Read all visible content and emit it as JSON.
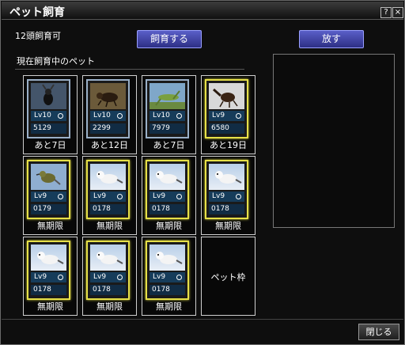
{
  "window": {
    "title": "ペット飼育",
    "help_label": "?",
    "close_label": "×"
  },
  "capacity_text": "12頭飼育可",
  "buttons": {
    "raise": "飼育する",
    "release": "放す",
    "close": "閉じる"
  },
  "section_label": "現在飼育中のペット",
  "pets": [
    {
      "level": "Lv10",
      "number": "5129",
      "remaining": "あと7日",
      "frame": "steel",
      "image": "stag-beetle-icon",
      "thumb_bg": "#3e4e60"
    },
    {
      "level": "Lv10",
      "number": "2299",
      "remaining": "あと12日",
      "frame": "steel",
      "image": "beetle-icon",
      "thumb_bg": "#6b5a3a"
    },
    {
      "level": "Lv10",
      "number": "7979",
      "remaining": "あと7日",
      "frame": "steel",
      "image": "grasshopper-icon",
      "thumb_bg": "#7fa7c9"
    },
    {
      "level": "Lv9",
      "number": "6580",
      "remaining": "あと19日",
      "frame": "gold",
      "image": "rhinoceros-beetle-icon",
      "thumb_bg": "#d8d8d8"
    },
    {
      "level": "Lv9",
      "number": "0179",
      "remaining": "無期限",
      "frame": "gold",
      "image": "bird-icon",
      "thumb_bg": "#8faed0"
    },
    {
      "level": "Lv9",
      "number": "0178",
      "remaining": "無期限",
      "frame": "gold",
      "image": "ferret-icon",
      "thumb_bg": "#9ab8d8"
    },
    {
      "level": "Lv9",
      "number": "0178",
      "remaining": "無期限",
      "frame": "gold",
      "image": "ferret-icon",
      "thumb_bg": "#9ab8d8"
    },
    {
      "level": "Lv9",
      "number": "0178",
      "remaining": "無期限",
      "frame": "gold",
      "image": "ferret-icon",
      "thumb_bg": "#9ab8d8"
    },
    {
      "level": "Lv9",
      "number": "0178",
      "remaining": "無期限",
      "frame": "gold",
      "image": "ferret-icon",
      "thumb_bg": "#9ab8d8"
    },
    {
      "level": "Lv9",
      "number": "0178",
      "remaining": "無期限",
      "frame": "gold",
      "image": "ferret-icon",
      "thumb_bg": "#9ab8d8"
    },
    {
      "level": "Lv9",
      "number": "0178",
      "remaining": "無期限",
      "frame": "gold",
      "image": "ferret-icon",
      "thumb_bg": "#9ab8d8"
    }
  ],
  "empty_slot_label": "ペット枠"
}
